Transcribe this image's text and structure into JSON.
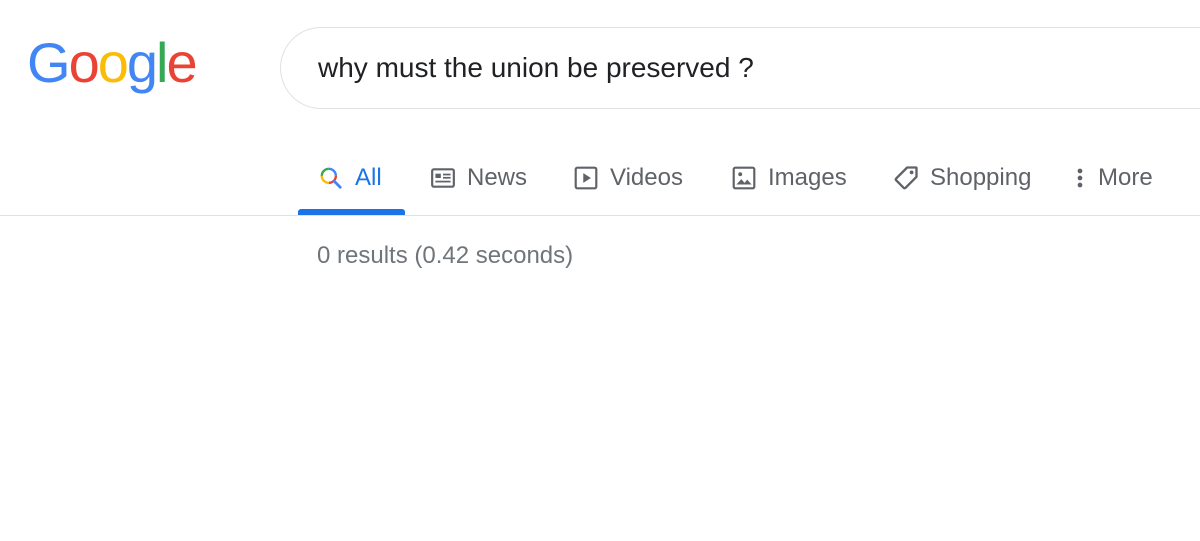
{
  "logo": {
    "letters": [
      "G",
      "o",
      "o",
      "g",
      "l",
      "e"
    ],
    "colors": {
      "blue": "#4285f4",
      "red": "#ea4335",
      "yellow": "#fbbc05",
      "green": "#34a853"
    }
  },
  "search": {
    "query": "why must the union be preserved ?"
  },
  "tabs": [
    {
      "label": "All",
      "icon": "search-icon",
      "active": true
    },
    {
      "label": "News",
      "icon": "news-icon",
      "active": false
    },
    {
      "label": "Videos",
      "icon": "video-play-icon",
      "active": false
    },
    {
      "label": "Images",
      "icon": "image-icon",
      "active": false
    },
    {
      "label": "Shopping",
      "icon": "tag-icon",
      "active": false
    },
    {
      "label": "More",
      "icon": "more-vert-icon",
      "active": false
    }
  ],
  "results": {
    "stats": "0 results (0.42 seconds)"
  },
  "theme": {
    "accent": "#1a73e8",
    "text_muted": "#5f6368",
    "divider": "#dfe1e5"
  }
}
